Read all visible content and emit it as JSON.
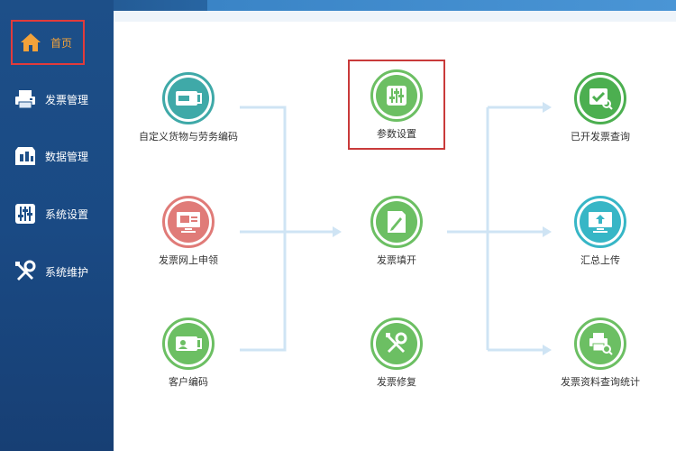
{
  "sidebar": {
    "items": [
      {
        "label": "首页",
        "icon": "home-icon",
        "active": true
      },
      {
        "label": "发票管理",
        "icon": "printer-icon"
      },
      {
        "label": "数据管理",
        "icon": "data-icon"
      },
      {
        "label": "系统设置",
        "icon": "sliders-icon"
      },
      {
        "label": "系统维护",
        "icon": "tools-icon"
      }
    ]
  },
  "colors": {
    "sidebar": "#1d4f88",
    "teal": "#3fa9a8",
    "pink": "#e07b78",
    "green": "#6cbf63",
    "greenDark": "#4caf50",
    "cyan": "#37b6c6",
    "arrow": "#cfe4f4",
    "highlight": "#c93a3a"
  },
  "flow": {
    "left": [
      {
        "label": "自定义货物与劳务编码",
        "icon": "card-icon"
      },
      {
        "label": "发票网上申领",
        "icon": "monitor-apply-icon"
      },
      {
        "label": "客户编码",
        "icon": "contact-card-icon"
      }
    ],
    "center": [
      {
        "label": "参数设置",
        "icon": "sliders-icon"
      },
      {
        "label": "发票填开",
        "icon": "pen-document-icon"
      },
      {
        "label": "发票修复",
        "icon": "tools-icon"
      }
    ],
    "right": [
      {
        "label": "已开发票查询",
        "icon": "search-document-icon"
      },
      {
        "label": "汇总上传",
        "icon": "upload-monitor-icon"
      },
      {
        "label": "发票资料查询统计",
        "icon": "printer-search-icon"
      }
    ]
  }
}
